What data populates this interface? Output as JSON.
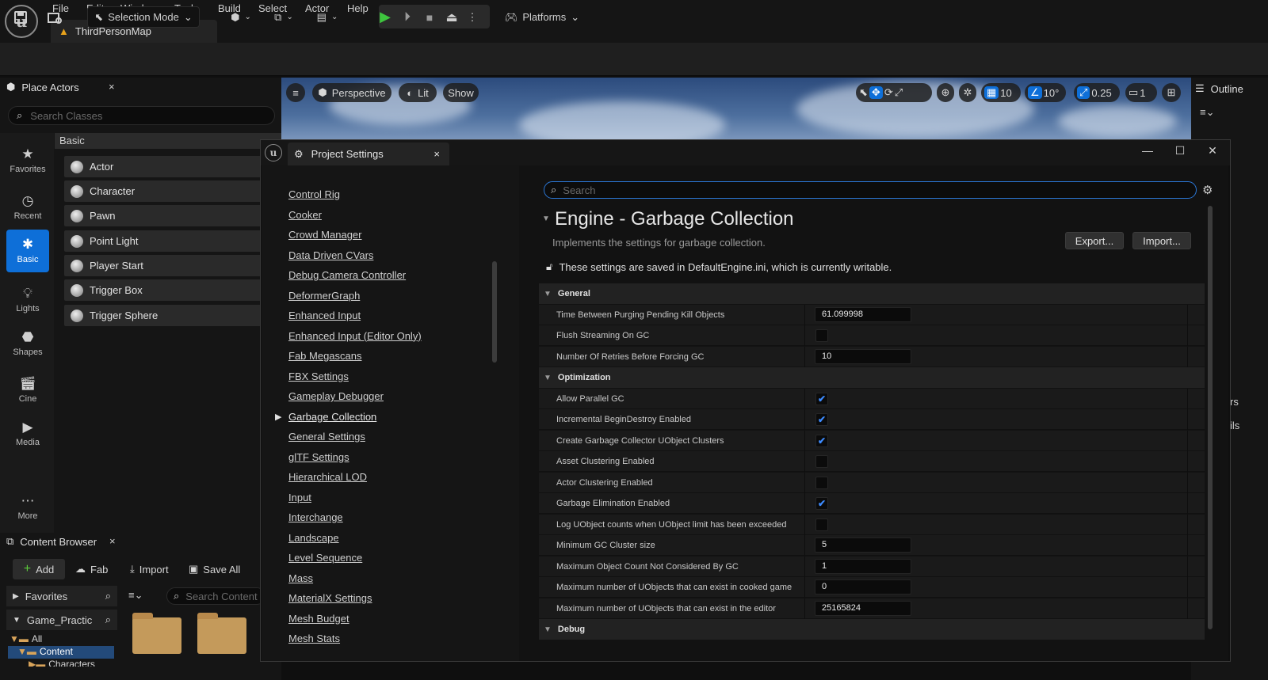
{
  "app": {
    "logo": "u"
  },
  "menu": [
    "File",
    "Edit",
    "Window",
    "Tools",
    "Build",
    "Select",
    "Actor",
    "Help"
  ],
  "map_tab": {
    "label": "ThirdPersonMap"
  },
  "toolbar": {
    "selection_mode": "Selection Mode",
    "platforms": "Platforms"
  },
  "place_actors": {
    "title": "Place Actors",
    "search_placeholder": "Search Classes",
    "categories": [
      {
        "label": "Favorites",
        "icon": "star-icon"
      },
      {
        "label": "Recent",
        "icon": "clock-icon"
      },
      {
        "label": "Basic",
        "icon": "basic-icon",
        "active": true
      },
      {
        "label": "Lights",
        "icon": "light-icon"
      },
      {
        "label": "Shapes",
        "icon": "shapes-icon"
      },
      {
        "label": "Cine",
        "icon": "cine-icon"
      },
      {
        "label": "Media",
        "icon": "media-icon"
      },
      {
        "label": "More",
        "icon": "more-icon"
      }
    ],
    "group_header": "Basic",
    "items": [
      "Actor",
      "Character",
      "Pawn",
      "Point Light",
      "Player Start",
      "Trigger Box",
      "Trigger Sphere"
    ]
  },
  "content_browser": {
    "title": "Content Browser",
    "add": "Add",
    "fab": "Fab",
    "import": "Import",
    "save_all": "Save All",
    "favorites": "Favorites",
    "project": "Game_Practic",
    "search_placeholder": "Search Content",
    "tree": {
      "all": "All",
      "content": "Content",
      "characters": "Characters"
    }
  },
  "viewport": {
    "perspective": "Perspective",
    "lit": "Lit",
    "show": "Show",
    "grid_snap": "10",
    "rot_snap": "10°",
    "scale_snap": "0.25",
    "camera_speed": "1"
  },
  "outliner": {
    "title": "Outline",
    "frag1": "rs",
    "frag2": "ils"
  },
  "project_settings": {
    "title": "Project Settings",
    "nav": [
      "Control Rig",
      "Cooker",
      "Crowd Manager",
      "Data Driven CVars",
      "Debug Camera Controller",
      "DeformerGraph",
      "Enhanced Input",
      "Enhanced Input (Editor Only)",
      "Fab Megascans",
      "FBX Settings",
      "Gameplay Debugger",
      "Garbage Collection",
      "General Settings",
      "glTF Settings",
      "Hierarchical LOD",
      "Input",
      "Interchange",
      "Landscape",
      "Level Sequence",
      "Mass",
      "MaterialX Settings",
      "Mesh Budget",
      "Mesh Stats"
    ],
    "selected_nav": "Garbage Collection",
    "search_placeholder": "Search",
    "section_title": "Engine - Garbage Collection",
    "section_desc": "Implements the settings for garbage collection.",
    "export": "Export...",
    "import": "Import...",
    "saved_note": "These settings are saved in DefaultEngine.ini, which is currently writable.",
    "groups": [
      {
        "name": "General",
        "rows": [
          {
            "label": "Time Between Purging Pending Kill Objects",
            "type": "number",
            "value": "61.099998"
          },
          {
            "label": "Flush Streaming On GC",
            "type": "check",
            "checked": false
          },
          {
            "label": "Number Of Retries Before Forcing GC",
            "type": "number",
            "value": "10"
          }
        ]
      },
      {
        "name": "Optimization",
        "rows": [
          {
            "label": "Allow Parallel GC",
            "type": "check",
            "checked": true
          },
          {
            "label": "Incremental BeginDestroy Enabled",
            "type": "check",
            "checked": true
          },
          {
            "label": "Create Garbage Collector UObject Clusters",
            "type": "check",
            "checked": true
          },
          {
            "label": "Asset Clustering Enabled",
            "type": "check",
            "checked": false
          },
          {
            "label": "Actor Clustering Enabled",
            "type": "check",
            "checked": false
          },
          {
            "label": "Garbage Elimination Enabled",
            "type": "check",
            "checked": true
          },
          {
            "label": "Log UObject counts when UObject limit has been exceeded",
            "type": "check",
            "checked": false
          },
          {
            "label": "Minimum GC Cluster size",
            "type": "number",
            "value": "5"
          },
          {
            "label": "Maximum Object Count Not Considered By GC",
            "type": "number",
            "value": "1"
          },
          {
            "label": "Maximum number of UObjects that can exist in cooked game",
            "type": "number",
            "value": "0"
          },
          {
            "label": "Maximum number of UObjects that can exist in the editor",
            "type": "number",
            "value": "25165824"
          }
        ]
      },
      {
        "name": "Debug",
        "rows": []
      }
    ]
  }
}
